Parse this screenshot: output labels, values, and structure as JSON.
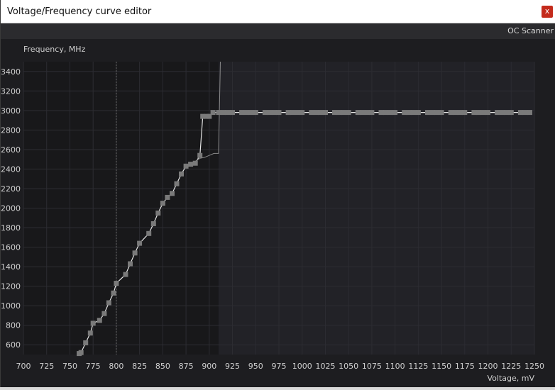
{
  "window": {
    "title": "Voltage/Frequency curve editor",
    "close_label": "x"
  },
  "toolbar": {
    "oc_scanner_label": "OC Scanner"
  },
  "colors": {
    "plot_bg_left": "#18181a",
    "plot_bg_right": "#222227",
    "grid": "#2c2c32",
    "curve": "#e6e6e6",
    "point": "#7a7a7a",
    "text": "#cfcfcf"
  },
  "chart_data": {
    "type": "line",
    "title": "",
    "xlabel": "Voltage, mV",
    "ylabel": "Frequency, MHz",
    "xlim": [
      700,
      1250
    ],
    "ylim": [
      500,
      3500
    ],
    "x_ticks": [
      700,
      725,
      750,
      775,
      800,
      825,
      850,
      875,
      900,
      925,
      950,
      975,
      1000,
      1025,
      1050,
      1075,
      1100,
      1125,
      1150,
      1175,
      1200,
      1225,
      1250
    ],
    "y_ticks": [
      600,
      800,
      1000,
      1200,
      1400,
      1600,
      1800,
      2000,
      2200,
      2400,
      2600,
      2800,
      3000,
      3200,
      3400
    ],
    "grid": true,
    "current_voltage_marker": 800,
    "locked_region_start": 910,
    "series": [
      {
        "x": [
          760,
          762,
          767,
          772,
          775,
          782,
          787,
          792,
          797,
          800,
          810,
          815,
          820,
          825,
          835,
          840,
          845,
          850,
          855,
          860,
          865,
          870,
          875,
          880,
          885,
          890,
          893,
          897,
          900,
          904,
          910,
          915,
          920,
          925,
          935,
          940,
          945,
          950,
          960,
          965,
          970,
          975,
          985,
          990,
          995,
          1000,
          1010,
          1015,
          1020,
          1025,
          1035,
          1040,
          1045,
          1050,
          1060,
          1065,
          1070,
          1075,
          1085,
          1090,
          1095,
          1100,
          1110,
          1115,
          1120,
          1125,
          1135,
          1140,
          1145,
          1150,
          1160,
          1165,
          1170,
          1175,
          1185,
          1190,
          1195,
          1200,
          1210,
          1215,
          1220,
          1225,
          1235,
          1240,
          1245
        ],
        "y": [
          510,
          520,
          620,
          720,
          820,
          850,
          920,
          1030,
          1130,
          1230,
          1320,
          1430,
          1540,
          1640,
          1740,
          1840,
          1950,
          2050,
          2110,
          2150,
          2250,
          2350,
          2430,
          2450,
          2460,
          2540,
          2940,
          2940,
          2940,
          2980,
          2980,
          2980,
          2980,
          2980,
          2980,
          2980,
          2980,
          2980,
          2980,
          2980,
          2980,
          2980,
          2980,
          2980,
          2980,
          2980,
          2980,
          2980,
          2980,
          2980,
          2980,
          2980,
          2980,
          2980,
          2980,
          2980,
          2980,
          2980,
          2980,
          2980,
          2980,
          2980,
          2980,
          2980,
          2980,
          2980,
          2980,
          2980,
          2980,
          2980,
          2980,
          2980,
          2980,
          2980,
          2980,
          2980,
          2980,
          2980,
          2980,
          2980,
          2980,
          2980,
          2980,
          2980,
          2980
        ]
      },
      {
        "x": [
          885,
          890,
          895,
          900,
          905,
          910,
          912
        ],
        "y": [
          2480,
          2510,
          2520,
          2540,
          2560,
          2560,
          3500
        ]
      }
    ]
  }
}
